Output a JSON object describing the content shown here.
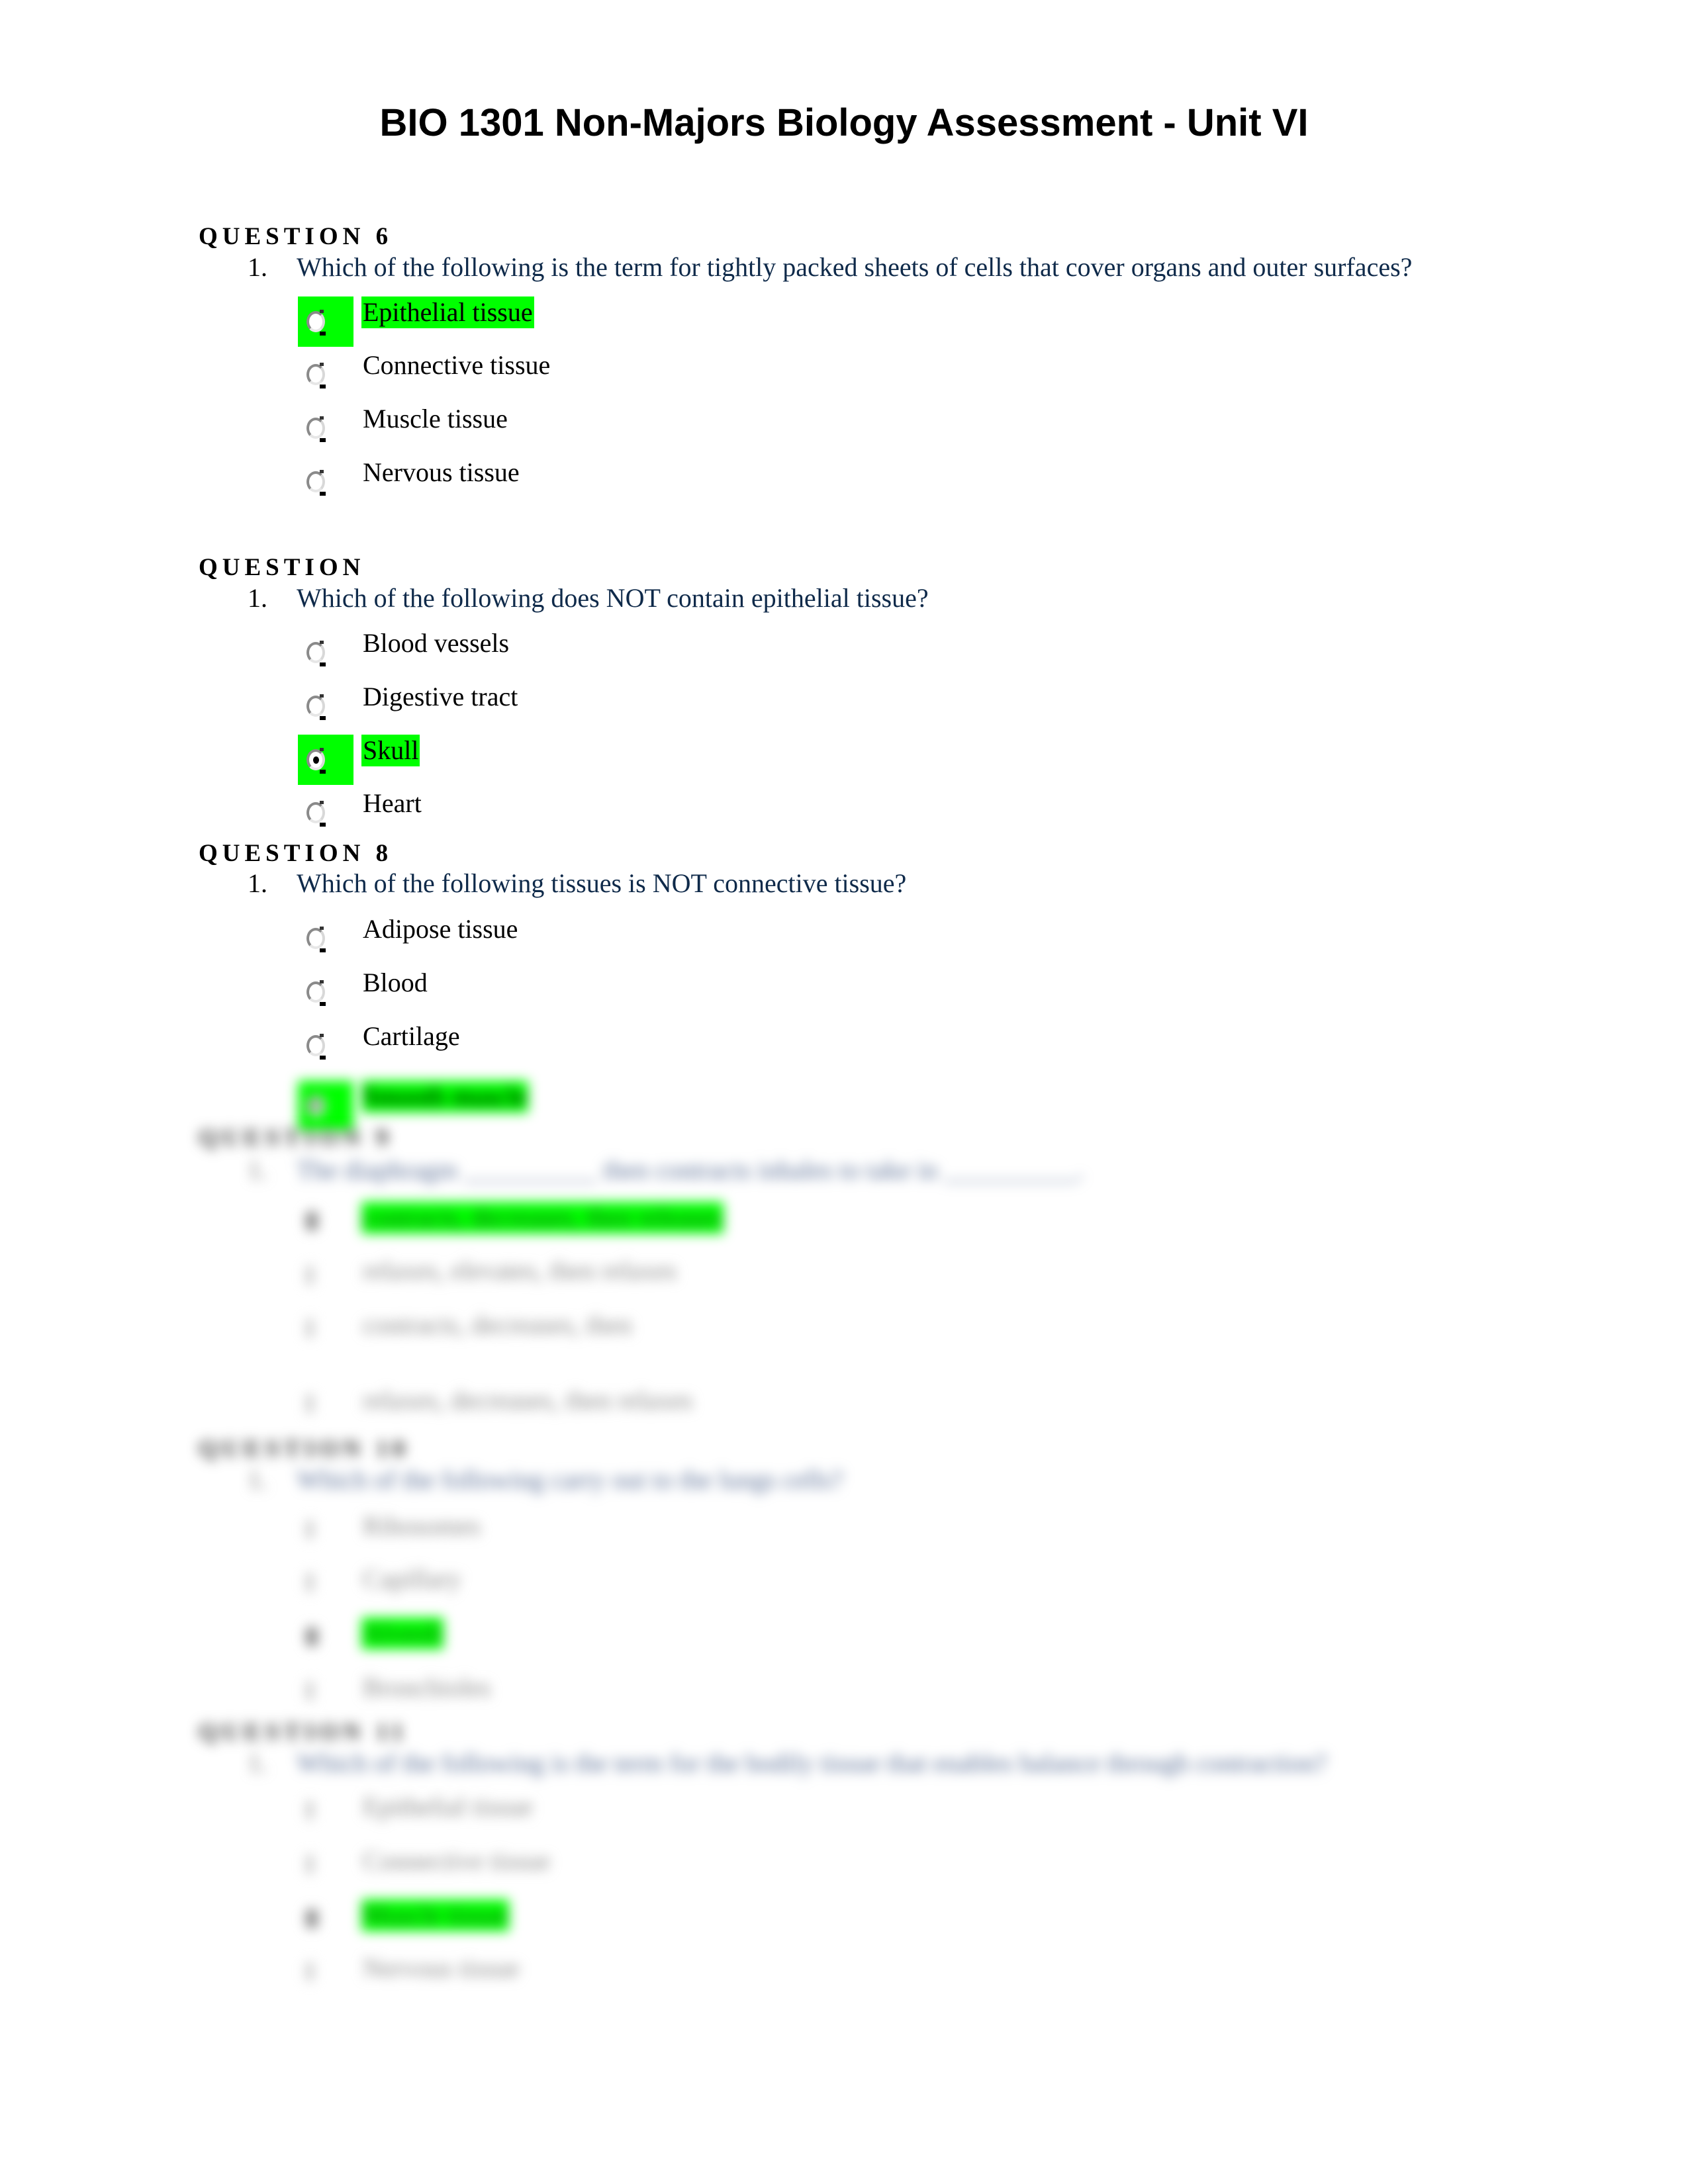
{
  "document": {
    "title": "BIO 1301 Non-Majors Biology Assessment - Unit VI"
  },
  "questions": [
    {
      "heading": "QUESTION 6",
      "number": "1.",
      "text": "Which of the following is the term for tightly packed sheets of cells that cover organs and outer surfaces?",
      "options": [
        {
          "label": "Epithelial tissue",
          "highlighted": true,
          "selected": false
        },
        {
          "label": "Connective tissue",
          "highlighted": false,
          "selected": false
        },
        {
          "label": "Muscle tissue",
          "highlighted": false,
          "selected": false
        },
        {
          "label": "Nervous tissue",
          "highlighted": false,
          "selected": false
        }
      ]
    },
    {
      "heading": "QUESTION",
      "number": "1.",
      "text": "Which of the following does NOT contain epithelial tissue?",
      "options": [
        {
          "label": "Blood vessels",
          "highlighted": false,
          "selected": false
        },
        {
          "label": "Digestive tract",
          "highlighted": false,
          "selected": false
        },
        {
          "label": "Skull",
          "highlighted": true,
          "selected": true
        },
        {
          "label": "Heart",
          "highlighted": false,
          "selected": false
        }
      ]
    },
    {
      "heading": "QUESTION 8",
      "number": "1.",
      "text": "Which of the following tissues is NOT connective tissue?",
      "options": [
        {
          "label": "Adipose tissue",
          "highlighted": false,
          "selected": false
        },
        {
          "label": "Blood",
          "highlighted": false,
          "selected": false
        },
        {
          "label": "Cartilage",
          "highlighted": false,
          "selected": false
        },
        {
          "label": "Smooth muscle",
          "highlighted": true,
          "selected": true
        }
      ]
    }
  ],
  "blurred_questions": [
    {
      "heading": "QUESTION 9",
      "number": "1.",
      "text": "The diaphragm __________ then contracts inhales to take in __________.",
      "options": [
        {
          "label": "contracts, decreases, then releases",
          "highlighted": true
        },
        {
          "label": "relaxes, elevates, then relaxes"
        },
        {
          "label": "contracts, decreases, then"
        },
        {
          "label": "relaxes, decreases, then relaxes"
        }
      ]
    },
    {
      "heading": "QUESTION 10",
      "number": "1.",
      "text": "Which of the following carry out to the lungs cells?",
      "options": [
        {
          "label": "Ribosomes"
        },
        {
          "label": "Capillary"
        },
        {
          "label": "Alveoli",
          "highlighted": true
        },
        {
          "label": "Bronchioles"
        }
      ]
    },
    {
      "heading": "QUESTION 11",
      "number": "1.",
      "text": "Which of the following is the term for the bodily tissue that enables balance through contraction?",
      "options": [
        {
          "label": "Epithelial tissue"
        },
        {
          "label": "Connective tissue"
        },
        {
          "label": "Muscle tissue",
          "highlighted": true
        },
        {
          "label": "Nervous tissue"
        }
      ]
    }
  ],
  "colors": {
    "highlight": "#00ff00",
    "question_text": "#0f2a4a",
    "body_text": "#000000"
  }
}
